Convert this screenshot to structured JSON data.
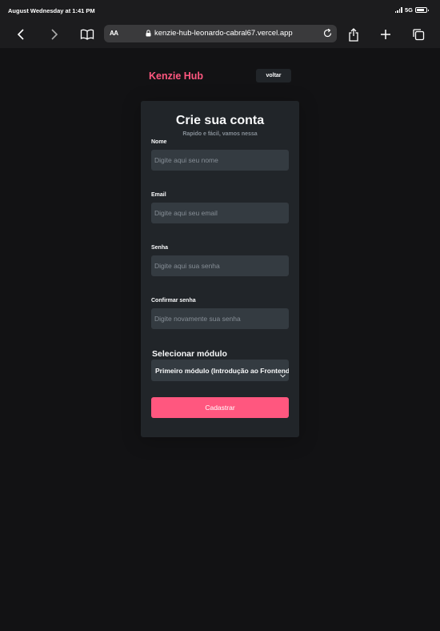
{
  "status_bar": {
    "time": "August Wednesday at 1:41 PM",
    "network": "5G"
  },
  "browser": {
    "text_size": "AA",
    "url": "kenzie-hub-leonardo-cabral67.vercel.app",
    "icons": [
      "chevron-left-icon",
      "chevron-right-icon",
      "book-icon",
      "lock-icon",
      "reload-icon",
      "share-icon",
      "plus-icon",
      "tabs-icon"
    ]
  },
  "header": {
    "logo": "Kenzie Hub",
    "back_label": "voltar"
  },
  "form": {
    "title": "Crie sua conta",
    "subtitle": "Rapido e fácil, vamos nessa",
    "fields": [
      {
        "label": "Nome",
        "placeholder": "Digite aqui seu nome",
        "value": ""
      },
      {
        "label": "Email",
        "placeholder": "Digite aqui seu email",
        "value": ""
      },
      {
        "label": "Senha",
        "placeholder": "Digite aqui sua senha",
        "value": ""
      },
      {
        "label": "Confirmar senha",
        "placeholder": "Digite novamente sua senha",
        "value": ""
      }
    ],
    "module_label": "Selecionar módulo",
    "module_selected": "Primeiro módulo (Introdução ao Frontend)",
    "submit_label": "Cadastrar"
  },
  "colors": {
    "brand": "#ff577f",
    "background": "#121214",
    "card": "#212529",
    "input": "#343b41",
    "placeholder": "#868e96"
  }
}
